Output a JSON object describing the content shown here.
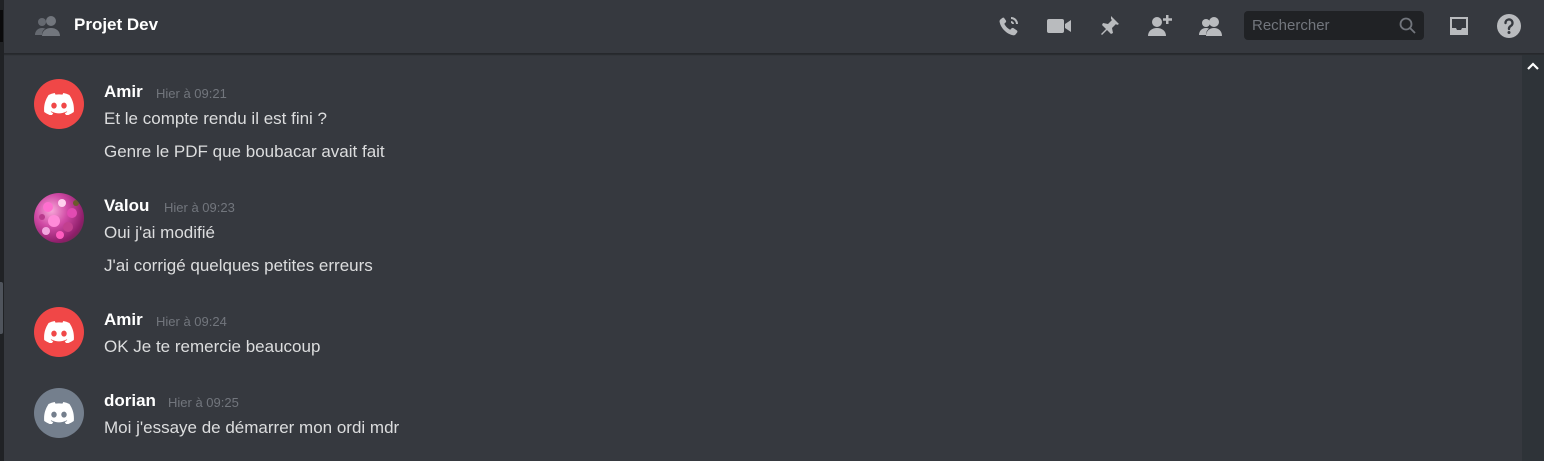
{
  "header": {
    "title": "Projet Dev",
    "icons": [
      "call-icon",
      "video-icon",
      "pin-icon",
      "add-member-icon",
      "members-icon",
      "inbox-icon",
      "help-icon"
    ],
    "search": {
      "placeholder": "Rechercher",
      "value": ""
    }
  },
  "messages": [
    {
      "author": "Amir",
      "time": "Hier à 09:21",
      "avatar": {
        "type": "discord-logo",
        "color": "#f04747"
      },
      "lines": [
        "Et le compte rendu il est fini ?",
        "Genre le PDF que boubacar avait fait"
      ]
    },
    {
      "author": "Valou",
      "time": "Hier à 09:23",
      "avatar": {
        "type": "photo-flowers",
        "color": "#c2408f"
      },
      "lines": [
        "Oui j'ai modifié",
        "J'ai corrigé quelques petites erreurs"
      ]
    },
    {
      "author": "Amir",
      "time": "Hier à 09:24",
      "avatar": {
        "type": "discord-logo",
        "color": "#f04747"
      },
      "lines": [
        "OK Je te remercie beaucoup"
      ]
    },
    {
      "author": "dorian",
      "time": "Hier à 09:25",
      "avatar": {
        "type": "discord-logo",
        "color": "#747f8d"
      },
      "lines": [
        "Moi j'essaye de démarrer mon ordi mdr"
      ]
    }
  ],
  "colors": {
    "background": "#36393f",
    "search_background": "#202225",
    "icon": "#b9bbbe",
    "timestamp": "#72767d"
  }
}
